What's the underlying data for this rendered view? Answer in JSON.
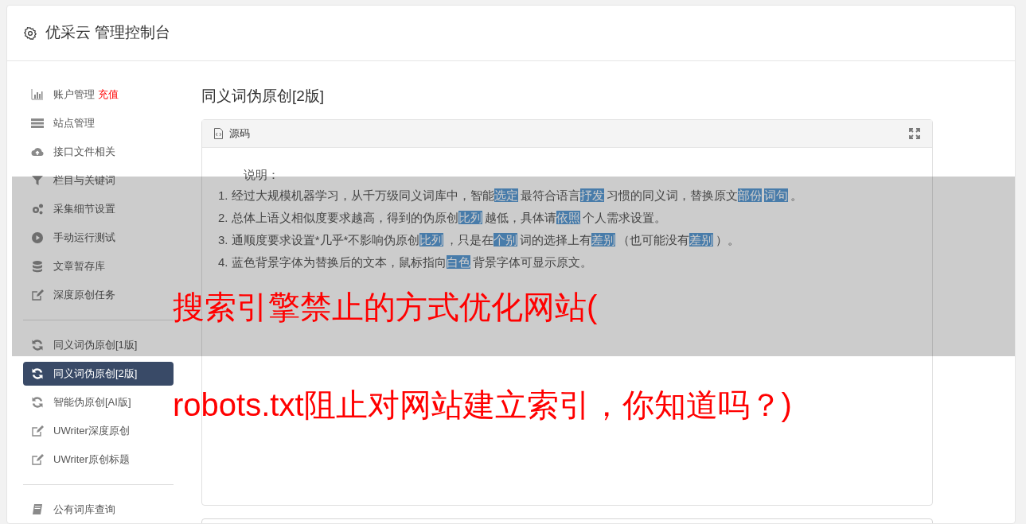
{
  "header": {
    "title": "优采云 管理控制台"
  },
  "sidebar": {
    "groups": [
      {
        "items": [
          {
            "kind": "chart",
            "label": "账户管理",
            "badge": "充值",
            "selected": false
          },
          {
            "kind": "server",
            "label": "站点管理",
            "selected": false
          },
          {
            "kind": "cloud",
            "label": "接口文件相关",
            "selected": false
          },
          {
            "kind": "filter",
            "label": "栏目与关键词",
            "selected": false
          },
          {
            "kind": "gears",
            "label": "采集细节设置",
            "selected": false
          },
          {
            "kind": "play",
            "label": "手动运行测试",
            "selected": false
          },
          {
            "kind": "database",
            "label": "文章暂存库",
            "selected": false
          },
          {
            "kind": "edit",
            "label": "深度原创任务",
            "selected": false
          }
        ]
      },
      {
        "items": [
          {
            "kind": "refresh",
            "label": "同义词伪原创[1版]",
            "selected": false
          },
          {
            "kind": "refresh",
            "label": "同义词伪原创[2版]",
            "selected": true
          },
          {
            "kind": "refresh",
            "label": "智能伪原创[AI版]",
            "selected": false
          },
          {
            "kind": "edit",
            "label": "UWriter深度原创",
            "selected": false
          },
          {
            "kind": "edit",
            "label": "UWriter原创标题",
            "selected": false
          }
        ]
      },
      {
        "items": [
          {
            "kind": "book",
            "label": "公有词库查询",
            "selected": false
          }
        ]
      }
    ]
  },
  "main": {
    "heading": "同义词伪原创[2版]",
    "panel": {
      "tab": "源码",
      "intro": "说明：",
      "lines": [
        [
          {
            "text": "1. 经过大规模机器学习，从千万级同义词库中，智能",
            "replaced": false
          },
          {
            "text": "选定",
            "replaced": true
          },
          {
            "text": "最符合语言",
            "replaced": false
          },
          {
            "text": "抒发",
            "replaced": true
          },
          {
            "text": "习惯的同义词，替换原文",
            "replaced": false
          },
          {
            "text": "部份",
            "replaced": true
          },
          {
            "text": "词句",
            "replaced": true
          },
          {
            "text": "。",
            "replaced": false
          }
        ],
        [
          {
            "text": "2. 总体上语义相似度要求越高，得到的伪原创",
            "replaced": false
          },
          {
            "text": "比列",
            "replaced": true
          },
          {
            "text": "越低，具体请",
            "replaced": false
          },
          {
            "text": "依照",
            "replaced": true
          },
          {
            "text": "个人需求设置。",
            "replaced": false
          }
        ],
        [
          {
            "text": "3. 通顺度要求设置*几乎*不影响伪原创",
            "replaced": false
          },
          {
            "text": "比列",
            "replaced": true
          },
          {
            "text": "，只是在",
            "replaced": false
          },
          {
            "text": "个别",
            "replaced": true
          },
          {
            "text": "词的选择上有",
            "replaced": false
          },
          {
            "text": "差别",
            "replaced": true
          },
          {
            "text": "（也可能没有",
            "replaced": false
          },
          {
            "text": "差别",
            "replaced": true
          },
          {
            "text": "）。",
            "replaced": false
          }
        ],
        [
          {
            "text": "4. 蓝色背景字体为替换后的文本，鼠标指向",
            "replaced": false
          },
          {
            "text": "白色",
            "replaced": true
          },
          {
            "text": "背景字体可显示原文。",
            "replaced": false
          }
        ]
      ]
    }
  },
  "overlay": {
    "lines": [
      "搜索引擎禁止的方式优化网站(",
      "robots.txt阻止对网站建立索引，你知道吗？)"
    ]
  }
}
